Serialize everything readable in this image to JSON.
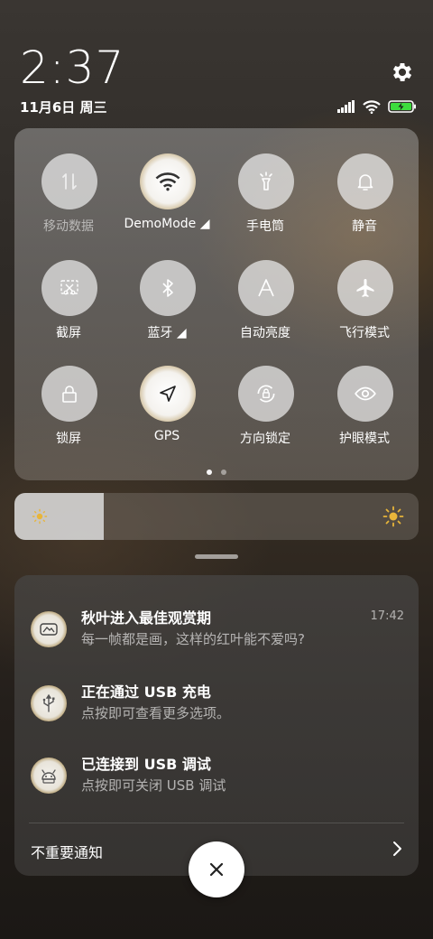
{
  "status": {
    "clock": "2:37",
    "date": "11月6日 周三",
    "icons": [
      "signal-icon",
      "wifi-icon",
      "battery-charging-icon"
    ]
  },
  "quick_settings": {
    "tiles": [
      {
        "label": "移动数据",
        "icon": "mobile-data-icon",
        "active": false,
        "dim": true
      },
      {
        "label": "DemoMode ◢",
        "icon": "wifi-icon",
        "active": true,
        "dim": false
      },
      {
        "label": "手电筒",
        "icon": "flashlight-icon",
        "active": false,
        "dim": false
      },
      {
        "label": "静音",
        "icon": "bell-icon",
        "active": false,
        "dim": false
      },
      {
        "label": "截屏",
        "icon": "screenshot-icon",
        "active": false,
        "dim": false
      },
      {
        "label": "蓝牙 ◢",
        "icon": "bluetooth-icon",
        "active": false,
        "dim": false
      },
      {
        "label": "自动亮度",
        "icon": "auto-brightness-icon",
        "active": false,
        "dim": false
      },
      {
        "label": "飞行模式",
        "icon": "airplane-icon",
        "active": false,
        "dim": false
      },
      {
        "label": "锁屏",
        "icon": "lock-icon",
        "active": false,
        "dim": false
      },
      {
        "label": "GPS",
        "icon": "location-arrow-icon",
        "active": true,
        "dim": false
      },
      {
        "label": "方向锁定",
        "icon": "rotation-lock-icon",
        "active": false,
        "dim": false
      },
      {
        "label": "护眼模式",
        "icon": "eye-icon",
        "active": false,
        "dim": false
      }
    ],
    "page_count": 2,
    "current_page": 1
  },
  "brightness": {
    "level": 0.22
  },
  "notifications": [
    {
      "title": "秋叶进入最佳观赏期",
      "text": "每一帧都是画，这样的红叶能不爱吗?",
      "time": "17:42",
      "icon": "app-icon"
    },
    {
      "title": "正在通过 USB 充电",
      "text": "点按即可查看更多选项。",
      "time": "",
      "icon": "usb-icon"
    },
    {
      "title": "已连接到 USB 调试",
      "text": "点按即可关闭 USB 调试",
      "time": "",
      "icon": "android-debug-icon"
    }
  ],
  "unimportant_label": "不重要通知",
  "colors": {
    "accent_gold": "#c9b48a",
    "battery_green": "#3ddc3d"
  }
}
